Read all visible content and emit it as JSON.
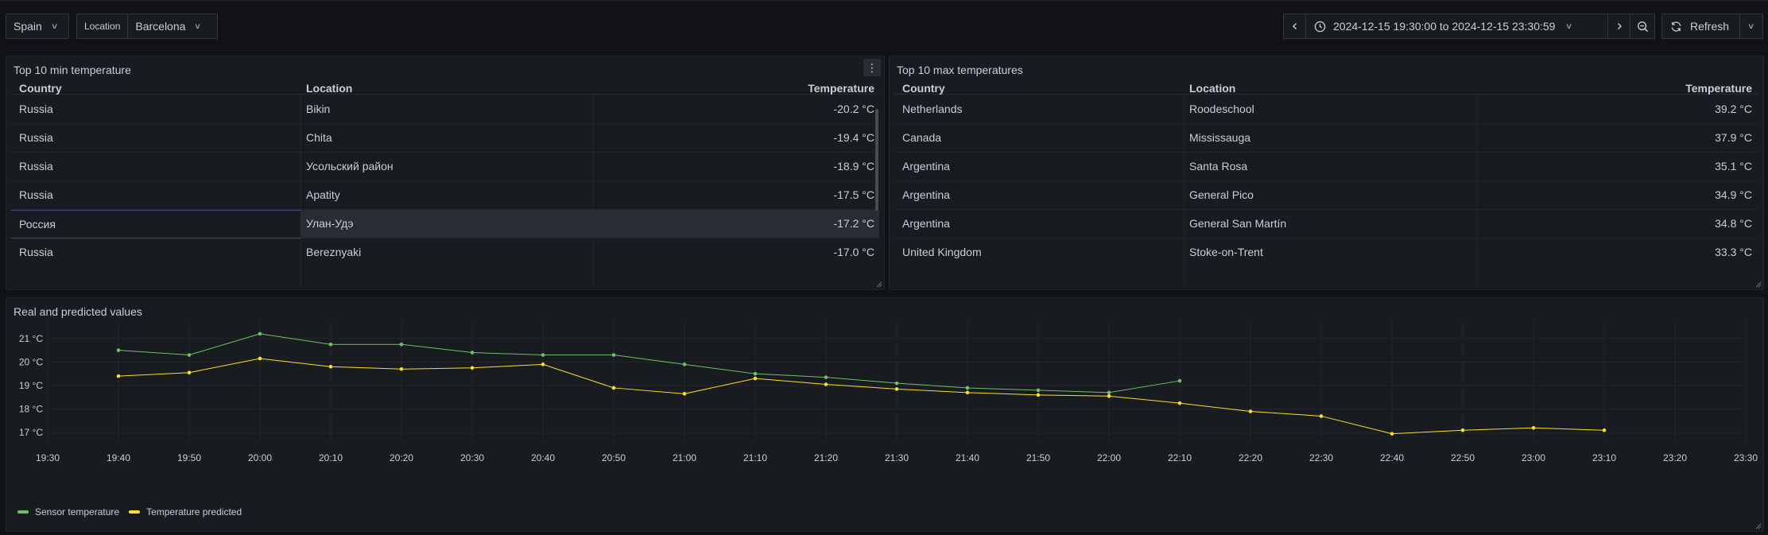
{
  "toolbar": {
    "country": "Spain",
    "location_label": "Location",
    "location_value": "Barcelona",
    "time_range": "2024-12-15 19:30:00 to 2024-12-15 23:30:59",
    "refresh_label": "Refresh"
  },
  "min_panel": {
    "title": "Top 10 min temperature",
    "columns": [
      "Country",
      "Location",
      "Temperature"
    ],
    "rows": [
      {
        "country": "Russia",
        "location": "Bikin",
        "temperature": "-20.2 °C"
      },
      {
        "country": "Russia",
        "location": "Chita",
        "temperature": "-19.4 °C"
      },
      {
        "country": "Russia",
        "location": "Усольский район",
        "temperature": "-18.9 °C"
      },
      {
        "country": "Russia",
        "location": "Apatity",
        "temperature": "-17.5 °C"
      },
      {
        "country": "Россия",
        "location": "Улан-Удэ",
        "temperature": "-17.2 °C"
      },
      {
        "country": "Russia",
        "location": "Bereznyaki",
        "temperature": "-17.0 °C"
      }
    ]
  },
  "max_panel": {
    "title": "Top 10 max temperatures",
    "columns": [
      "Country",
      "Location",
      "Temperature"
    ],
    "rows": [
      {
        "country": "Netherlands",
        "location": "Roodeschool",
        "temperature": "39.2 °C"
      },
      {
        "country": "Canada",
        "location": "Mississauga",
        "temperature": "37.9 °C"
      },
      {
        "country": "Argentina",
        "location": "Santa Rosa",
        "temperature": "35.1 °C"
      },
      {
        "country": "Argentina",
        "location": "General Pico",
        "temperature": "34.9 °C"
      },
      {
        "country": "Argentina",
        "location": "General San Martín",
        "temperature": "34.8 °C"
      },
      {
        "country": "United Kingdom",
        "location": "Stoke-on-Trent",
        "temperature": "33.3 °C"
      }
    ]
  },
  "chart_panel": {
    "title": "Real and predicted values"
  },
  "colors": {
    "sensor": "#73bf69",
    "predicted": "#fade2a",
    "background": "#111217",
    "panel": "#181b1f"
  },
  "chart_data": {
    "type": "line",
    "title": "Real and predicted values",
    "x_ticks": [
      "19:30",
      "19:40",
      "19:50",
      "20:00",
      "20:10",
      "20:20",
      "20:30",
      "20:40",
      "20:50",
      "21:00",
      "21:10",
      "21:20",
      "21:30",
      "21:40",
      "21:50",
      "22:00",
      "22:10",
      "22:20",
      "22:30",
      "22:40",
      "22:50",
      "23:00",
      "23:10",
      "23:20",
      "23:30"
    ],
    "y_ticks": [
      "17 °C",
      "18 °C",
      "19 °C",
      "20 °C",
      "21 °C"
    ],
    "ylim": [
      16.6,
      21.5
    ],
    "legend_position": "bottom-left",
    "series": [
      {
        "name": "Sensor temperature",
        "color": "#73bf69",
        "x": [
          "19:40",
          "19:50",
          "20:00",
          "20:10",
          "20:20",
          "20:30",
          "20:40",
          "20:50",
          "21:00",
          "21:10",
          "21:20",
          "21:30",
          "21:40",
          "21:50",
          "22:00",
          "22:10"
        ],
        "values": [
          20.5,
          20.3,
          21.2,
          20.75,
          20.75,
          20.4,
          20.3,
          20.3,
          19.9,
          19.5,
          19.35,
          19.1,
          18.9,
          18.8,
          18.7,
          19.2
        ]
      },
      {
        "name": "Temperature predicted",
        "color": "#fade2a",
        "x": [
          "19:40",
          "19:50",
          "20:00",
          "20:10",
          "20:20",
          "20:30",
          "20:40",
          "20:50",
          "21:00",
          "21:10",
          "21:20",
          "21:30",
          "21:40",
          "21:50",
          "22:00",
          "22:10",
          "22:20",
          "22:30",
          "22:40",
          "22:50",
          "23:00",
          "23:10"
        ],
        "values": [
          19.4,
          19.55,
          20.15,
          19.8,
          19.7,
          19.75,
          19.9,
          18.9,
          18.65,
          19.3,
          19.05,
          18.85,
          18.7,
          18.6,
          18.55,
          18.25,
          17.9,
          17.7,
          16.95,
          17.1,
          17.2,
          17.1
        ]
      }
    ]
  }
}
